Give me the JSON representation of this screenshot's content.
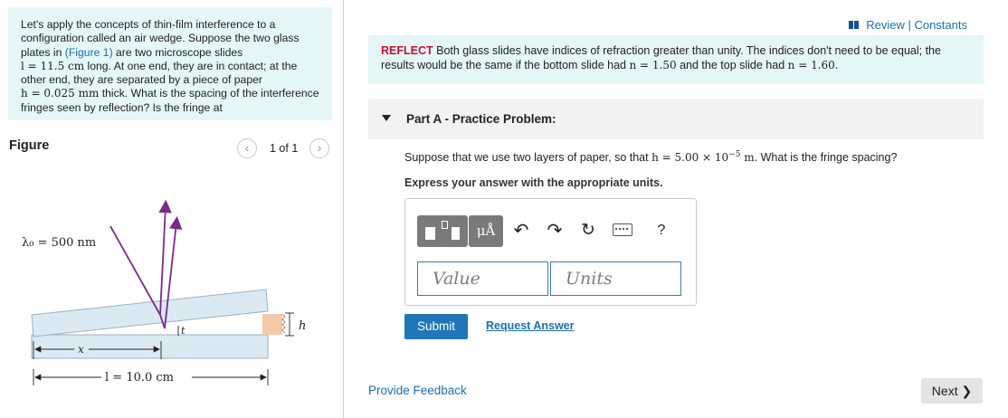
{
  "problem": {
    "intro": "Let's apply the concepts of thin-film interference to a configuration called an air wedge. Suppose the two glass plates in",
    "figure_link": "(Figure 1)",
    "mid": "are two microscope slides",
    "length_math": "l = 11.5 cm",
    "length_text": "long. At one end, they are in contact; at the other end, they are separated by a piece of paper",
    "thickness_math": "h = 0.025 mm",
    "end": "thick. What is the spacing of the interference fringes seen by reflection? Is the fringe at"
  },
  "figure": {
    "title": "Figure",
    "page": "1 of 1",
    "prev_icon": "chevron-left-icon",
    "next_icon": "chevron-right-icon",
    "wavelength_label": "λ₀ = 500 nm",
    "x_label": "x",
    "t_label": "t",
    "h_label": "h",
    "length_label": "l = 10.0 cm",
    "colors": {
      "ray": "#7b2a8c",
      "glass": "#dbe9f3",
      "glass_edge": "#9bb0c0",
      "paper": "#f3c9a8"
    }
  },
  "header": {
    "review": "Review | Constants",
    "review_icon": "book-icon"
  },
  "reflect": {
    "label": "REFLECT",
    "text": "Both glass slides have indices of refraction greater than unity. The indices don't need to be equal; the results would be the same if the bottom slide had",
    "n_bottom": "n = 1.50",
    "and_text": "and the top slide had",
    "n_top": "n = 1.60",
    "end": "."
  },
  "part": {
    "title": "Part A - Practice Problem:",
    "caret_icon": "caret-down-icon"
  },
  "question": {
    "text": "Suppose that we use two layers of paper, so that",
    "h_math": "h = 5.00 × 10",
    "exp": "−5",
    "unit": " m",
    "end": ". What is the fringe spacing?"
  },
  "express": "Express your answer with the appropriate units.",
  "toolbar": {
    "mu_label": "μÅ",
    "undo_icon": "undo-icon",
    "redo_icon": "redo-icon",
    "reset_icon": "reset-icon",
    "keyboard_icon": "keyboard-icon",
    "help_label": "?"
  },
  "inputs": {
    "value_placeholder": "Value",
    "units_placeholder": "Units"
  },
  "actions": {
    "submit": "Submit",
    "request_answer": "Request Answer",
    "feedback": "Provide Feedback",
    "next": "Next ❯"
  },
  "colors": {
    "accent": "#1f76b8",
    "link": "#1a6fb5",
    "highlight_bg": "#e5f6f6",
    "reflect_label": "#c8102e"
  }
}
